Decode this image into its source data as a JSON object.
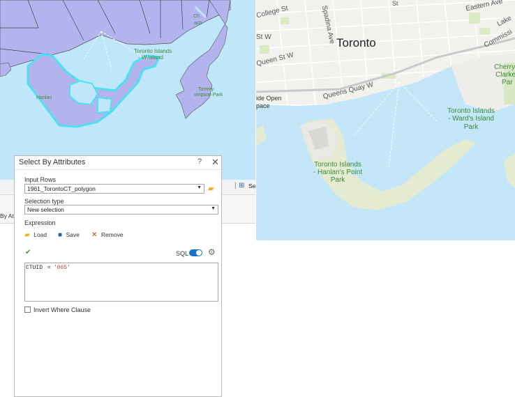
{
  "left_map": {
    "labels": {
      "toronto_islands": "Toronto Islands",
      "wards_island": "- W   Island",
      "hanlan": "Hanlan",
      "tommy_park": "Tommy",
      "thompson_park": "ompson Park",
      "ch": "Ch",
      "beach": "ach"
    }
  },
  "right_map": {
    "city_label": "Toronto",
    "streets": {
      "college": "College St",
      "spadina": "Spadina Ave",
      "queen": "Queen St W",
      "st": "St W",
      "queens_quay": "Queens Quay W",
      "eastern": "Eastern Ave",
      "lake": "Lake",
      "commissioners": "Commissi",
      "st_top": "St"
    },
    "places": {
      "ide_open": "ide Open",
      "space": "pace",
      "wards_l1": "Toronto Islands",
      "wards_l2": "- Ward's Island",
      "wards_l3": "Park",
      "hanlans_l1": "Toronto Islands",
      "hanlans_l2": "- Hanlan's Point",
      "hanlans_l3": "Park",
      "cherry1": "Cherry",
      "cherry2": "Clarke",
      "cherry3": "Par"
    }
  },
  "toolbar": {
    "partial_label": "Se",
    "side_tab": "By Att"
  },
  "dialog": {
    "title": "Select By Attributes",
    "help": "?",
    "close": "✕",
    "input_rows_label": "Input Rows",
    "input_rows_value": "1961_TorontoCT_polygon",
    "selection_type_label": "Selection type",
    "selection_type_value": "New selection",
    "expression_label": "Expression",
    "load_label": "Load",
    "save_label": "Save",
    "remove_label": "Remove",
    "sql_label": "SQL",
    "expression_field": "CTUID",
    "expression_op": "=",
    "expression_value": "'065'",
    "invert_label": "Invert Where Clause"
  },
  "colors": {
    "water": "#bfe6f9",
    "land_selected_layer": "#b3b4ee",
    "selection_outline": "#4de0f0",
    "sql_toggle": "#1a73c8",
    "expr_value": "#c0392b"
  }
}
